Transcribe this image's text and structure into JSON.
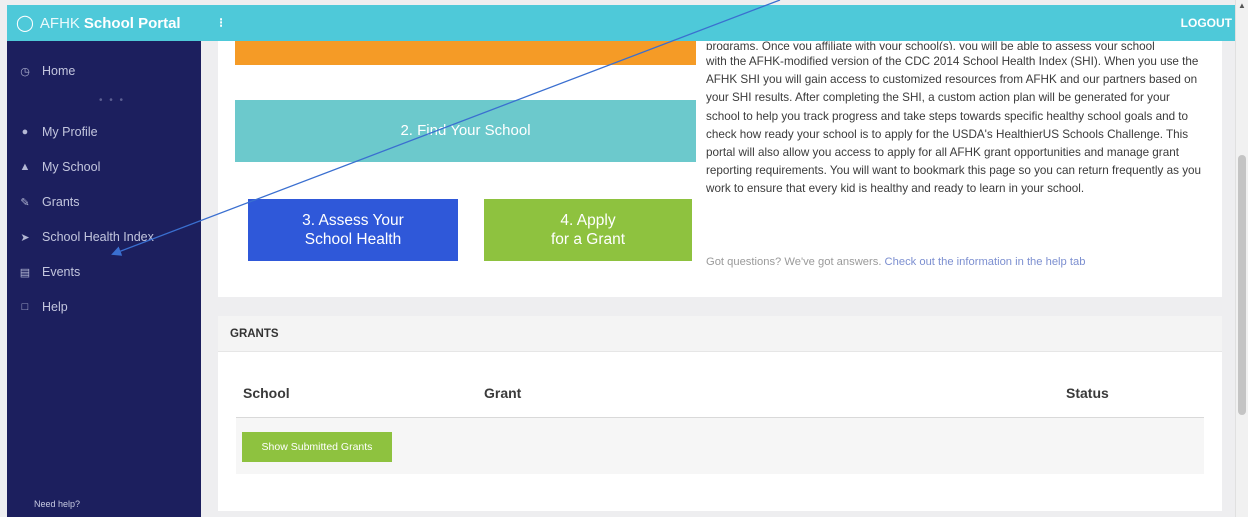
{
  "brand": {
    "prefix": "AFHK",
    "name": "School Portal"
  },
  "topbar": {
    "menu_glyph": "⁝",
    "logout": "LOGOUT"
  },
  "sidebar": {
    "items": [
      {
        "label": "Home",
        "icon": "clock-icon"
      },
      {
        "label": "My Profile",
        "icon": "user-icon"
      },
      {
        "label": "My School",
        "icon": "graduation-cap-icon"
      },
      {
        "label": "Grants",
        "icon": "pencil-icon"
      },
      {
        "label": "School Health Index",
        "icon": "rocket-icon"
      },
      {
        "label": "Events",
        "icon": "calendar-icon"
      },
      {
        "label": "Help",
        "icon": "chat-icon"
      }
    ],
    "separator": "• • •",
    "need_help": "Need help?"
  },
  "steps": {
    "step1": "",
    "step2": "2. Find Your School",
    "step3_line1": "3. Assess Your",
    "step3_line2": "School Health",
    "step4_line1": "4. Apply",
    "step4_line2": "for a Grant"
  },
  "intro": {
    "clipped_line": "programs. Once you affiliate with your school(s), you will be able to assess your school",
    "body": "with the AFHK-modified version of the CDC 2014 School Health Index (SHI). When you use the AFHK SHI you will gain access to customized resources from AFHK and our partners based on your SHI results. After completing the SHI, a custom action plan will be generated for your school to help you track progress and take steps towards specific healthy school goals and to check how ready your school is to apply for the USDA's HealthierUS Schools Challenge. This portal will also allow you access to apply for all AFHK grant opportunities and manage grant reporting requirements. You will want to bookmark this page so you can return frequently as you work to ensure that every kid is healthy and ready to learn in your school.",
    "questions": "Got questions? We've got answers.",
    "help_link": "Check out the information in the help tab"
  },
  "grants": {
    "header": "GRANTS",
    "columns": [
      "School",
      "Grant",
      "Status"
    ],
    "show_submitted": "Show Submitted Grants"
  },
  "colors": {
    "sidebar": "#1c1f5e",
    "topbar": "#4ec9d9",
    "orange": "#f59b26",
    "teal": "#6cc9cc",
    "blue": "#2f58d9",
    "green": "#8ec23f",
    "annotation_arrow": "#3a6fd0"
  }
}
